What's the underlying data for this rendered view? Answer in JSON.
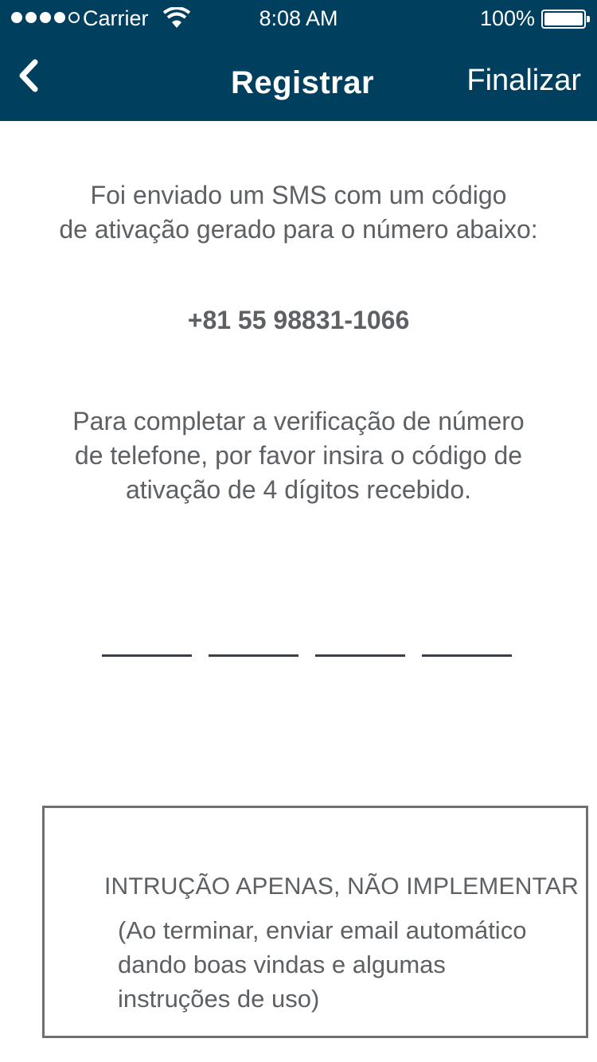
{
  "status_bar": {
    "carrier": "Carrier",
    "time": "8:08 AM",
    "battery": "100%"
  },
  "nav": {
    "title": "Registrar",
    "finish_label": "Finalizar",
    "back_icon": "chevron-left-icon"
  },
  "content": {
    "sms_line1": "Foi enviado um SMS com um código",
    "sms_line2": "de ativação gerado para o número abaixo:",
    "phone": "+81 55 98831-1066",
    "verify_line1": "Para completar a verificação de número",
    "verify_line2": "de telefone, por favor insira o código de",
    "verify_line3": "ativação de 4 dígitos recebido."
  },
  "code_digits": [
    "",
    "",
    "",
    ""
  ],
  "note": {
    "title": "INTRUÇÃO APENAS, NÃO IMPLEMENTAR",
    "line1": "(Ao terminar, enviar email automático",
    "line2": "dando boas vindas e algumas",
    "line3": "instruções de uso)"
  },
  "colors": {
    "header_bg": "#003f5e",
    "text": "#5d6064"
  }
}
